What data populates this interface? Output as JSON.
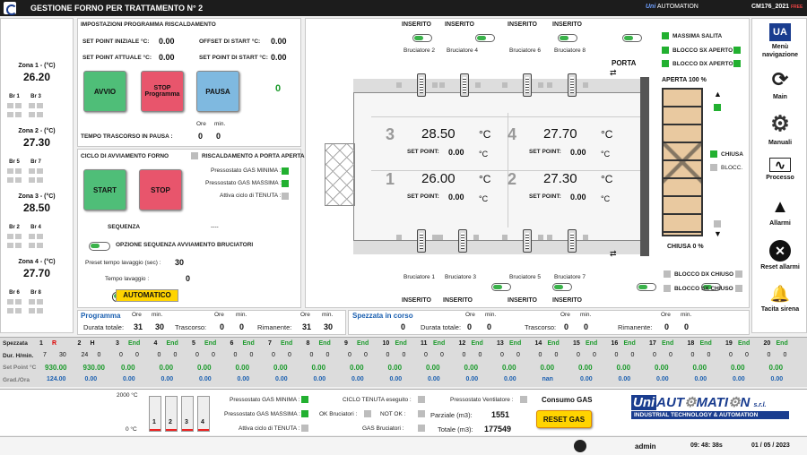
{
  "header": {
    "title": "GESTIONE FORNO PER TRATTAMENTO N° 2",
    "brand_logo": "Uni",
    "brand_text": "AUTOMATION",
    "code": "CM176_2021",
    "code_sub": "FREE"
  },
  "zones": [
    {
      "label": "Zona 1 - (°C)",
      "value": "26.20",
      "br": [
        "Br 1",
        "Br 3"
      ]
    },
    {
      "label": "Zona 2 - (°C)",
      "value": "27.30",
      "br": [
        "Br 5",
        "Br 7"
      ]
    },
    {
      "label": "Zona 3 - (°C)",
      "value": "28.50",
      "br": [
        "Br 2",
        "Br 4"
      ]
    },
    {
      "label": "Zona 4 - (°C)",
      "value": "27.70",
      "br": [
        "Br 6",
        "Br 8"
      ]
    }
  ],
  "heating": {
    "title": "IMPOSTAZIONI PROGRAMMA RISCALDAMENTO",
    "sp_initial_label": "SET POINT INIZIALE  °C:",
    "sp_initial": "0.00",
    "offset_label": "OFFSET DI START  °C:",
    "offset": "0.00",
    "sp_actual_label": "SET POINT ATTUALE  °C:",
    "sp_actual": "0.00",
    "sp_start_label": "SET POINT DI START  °C:",
    "sp_start": "0.00",
    "avvio": "AVVIO",
    "stop": "STOP",
    "stop_sub": "Programma",
    "pausa": "PAUSA",
    "counter": "0",
    "ore": "Ore",
    "min": "min.",
    "pause_label": "TEMPO TRASCORSO IN PAUSA :",
    "pause_ore": "0",
    "pause_min": "0"
  },
  "cycle": {
    "title": "CICLO DI AVVIAMENTO FORNO",
    "door_label": "RISCALDAMENTO A PORTA APERTA",
    "start": "START",
    "stop": "STOP",
    "gas_min": "Pressostato GAS MINIMA :",
    "gas_max": "Pressostato GAS MASSIMA :",
    "tenuta": "Attiva ciclo di TENUTA :",
    "seq_label": "SEQUENZA",
    "seq_val": "----",
    "option_label": "OPZIONE SEQUENZA AVVIAMENTO BRUCIATORI",
    "preset_label": "Preset tempo lavaggio (sec) :",
    "preset_val": "30",
    "tempo_label": "Tempo lavaggio :",
    "tempo_val": "0",
    "mode": "AUTOMATICO"
  },
  "oven": {
    "inserito": "INSERITO",
    "burners_top": [
      "Bruciatore 2",
      "Bruciatore 4",
      "Bruciatore 6",
      "Bruciatore 8"
    ],
    "burners_bottom": [
      "Bruciatore 1",
      "Bruciatore 3",
      "Bruciatore 5",
      "Bruciatore 7"
    ],
    "porta": "PORTA",
    "aperta": "APERTA  100 %",
    "chiusa_pct": "CHIUSA   0 %",
    "unit": "°C",
    "sp_label": "SET POINT:",
    "zones": [
      {
        "n": "3",
        "t": "28.50",
        "sp": "0.00"
      },
      {
        "n": "4",
        "t": "27.70",
        "sp": "0.00"
      },
      {
        "n": "1",
        "t": "26.00",
        "sp": "0.00"
      },
      {
        "n": "2",
        "t": "27.30",
        "sp": "0.00"
      }
    ],
    "massima": "MASSIMA SALITA",
    "blocco_sx_ap": "BLOCCO SX APERTO",
    "blocco_dx_ap": "BLOCCO DX APERTO",
    "chiusa": "CHIUSA",
    "blocc": "BLOCC.",
    "blocco_dx_ch": "BLOCCO DX CHIUSO",
    "blocco_sx_ch": "BLOCCO SX CHIUSO"
  },
  "sidebar": [
    {
      "label": "Menù navigazione",
      "icon": "ua-logo-icon"
    },
    {
      "label": "Main",
      "icon": "refresh-icon"
    },
    {
      "label": "Manuali",
      "icon": "gear-icon"
    },
    {
      "label": "Processo",
      "icon": "wave-icon"
    },
    {
      "label": "Allarmi",
      "icon": "warning-icon"
    },
    {
      "label": "Reset allarmi",
      "icon": "close-icon"
    },
    {
      "label": "Tacita sirena",
      "icon": "bell-icon"
    }
  ],
  "program": {
    "title": "Programma",
    "durata_label": "Durata totale:",
    "ore": "Ore",
    "min": "min.",
    "d_ore": "31",
    "d_min": "30",
    "trasc_label": "Trascorso:",
    "t_ore": "0",
    "t_min": "0",
    "rim_label": "Rimanente:",
    "r_ore": "31",
    "r_min": "30"
  },
  "spezzata": {
    "title": "Spezzata in corso",
    "durata_label": "Durata totale:",
    "d_val": "0",
    "d_ore": "0",
    "d_min": "0",
    "trasc_label": "Trascorso:",
    "t_ore": "0",
    "t_min": "0",
    "rim_label": "Rimanente:",
    "r_ore": "0",
    "r_min": "0"
  },
  "table": {
    "row_labels": [
      "Spezzata",
      "Dur. H/min.",
      "Set Point °C",
      "Grad./Ora"
    ],
    "cols": [
      {
        "n": "1",
        "tag": "R",
        "h": "7",
        "m": "30",
        "sp": "930.00",
        "gr": "124.00"
      },
      {
        "n": "2",
        "tag": "H",
        "h": "24",
        "m": "0",
        "sp": "930.00",
        "gr": "0.00"
      },
      {
        "n": "3",
        "tag": "End",
        "h": "0",
        "m": "0",
        "sp": "0.00",
        "gr": "0.00"
      },
      {
        "n": "4",
        "tag": "End",
        "h": "0",
        "m": "0",
        "sp": "0.00",
        "gr": "0.00"
      },
      {
        "n": "5",
        "tag": "End",
        "h": "0",
        "m": "0",
        "sp": "0.00",
        "gr": "0.00"
      },
      {
        "n": "6",
        "tag": "End",
        "h": "0",
        "m": "0",
        "sp": "0.00",
        "gr": "0.00"
      },
      {
        "n": "7",
        "tag": "End",
        "h": "0",
        "m": "0",
        "sp": "0.00",
        "gr": "0.00"
      },
      {
        "n": "8",
        "tag": "End",
        "h": "0",
        "m": "0",
        "sp": "0.00",
        "gr": "0.00"
      },
      {
        "n": "9",
        "tag": "End",
        "h": "0",
        "m": "0",
        "sp": "0.00",
        "gr": "0.00"
      },
      {
        "n": "10",
        "tag": "End",
        "h": "0",
        "m": "0",
        "sp": "0.00",
        "gr": "0.00"
      },
      {
        "n": "11",
        "tag": "End",
        "h": "0",
        "m": "0",
        "sp": "0.00",
        "gr": "0.00"
      },
      {
        "n": "12",
        "tag": "End",
        "h": "0",
        "m": "0",
        "sp": "0.00",
        "gr": "0.00"
      },
      {
        "n": "13",
        "tag": "End",
        "h": "0",
        "m": "0",
        "sp": "0.00",
        "gr": "0.00"
      },
      {
        "n": "14",
        "tag": "End",
        "h": "0",
        "m": "0",
        "sp": "0.00",
        "gr": "nan"
      },
      {
        "n": "15",
        "tag": "End",
        "h": "0",
        "m": "0",
        "sp": "0.00",
        "gr": "0.00"
      },
      {
        "n": "16",
        "tag": "End",
        "h": "0",
        "m": "0",
        "sp": "0.00",
        "gr": "0.00"
      },
      {
        "n": "17",
        "tag": "End",
        "h": "0",
        "m": "0",
        "sp": "0.00",
        "gr": "0.00"
      },
      {
        "n": "18",
        "tag": "End",
        "h": "0",
        "m": "0",
        "sp": "0.00",
        "gr": "0.00"
      },
      {
        "n": "19",
        "tag": "End",
        "h": "0",
        "m": "0",
        "sp": "0.00",
        "gr": "0.00"
      },
      {
        "n": "20",
        "tag": "End",
        "h": "0",
        "m": "0",
        "sp": "0.00",
        "gr": "0.00"
      }
    ]
  },
  "bottom": {
    "scale_top": "2000 °C",
    "scale_bot": "0 °C",
    "bars": [
      {
        "n": "1",
        "fill": 0.01
      },
      {
        "n": "2",
        "fill": 0.01
      },
      {
        "n": "3",
        "fill": 0.01
      },
      {
        "n": "4",
        "fill": 0.01
      }
    ],
    "gas_min": "Pressostato GAS MINIMA :",
    "gas_max": "Pressostato GAS MASSIMA :",
    "tenuta": "Attiva ciclo di TENUTA :",
    "ciclo": "CICLO TENUTA eseguito :",
    "ok_bruc": "OK Bruciatori :",
    "not_ok": "NOT OK :",
    "gas_bruc": "GAS Bruciatori :",
    "press_vent": "Pressostato Ventilatore :",
    "parziale_label": "Parziale (m3):",
    "parziale": "1551",
    "totale_label": "Totale (m3):",
    "totale": "177549",
    "consumo": "Consumo GAS",
    "reset": "RESET GAS",
    "company_a": "Uni",
    "company_b": "AUT",
    "company_c": "MATI",
    "company_d": "N",
    "company_srl": "s.r.l.",
    "company_sub": "INDUSTRIAL TECHNOLOGY & AUTOMATION"
  },
  "status": {
    "user": "admin",
    "time": "09: 48: 38s",
    "date": "01 / 05 / 2023"
  },
  "colors": {
    "green": "#22b030",
    "yellow": "#ffd400",
    "red_btn": "#e8556c",
    "blue_btn": "#7fb9e0",
    "green_btn": "#4fbe78"
  }
}
